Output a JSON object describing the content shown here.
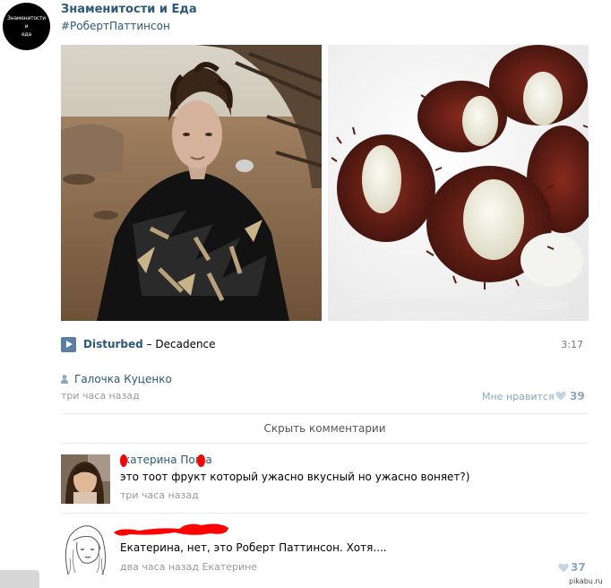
{
  "group": {
    "avatar_lines": [
      "Знаменитости",
      "и",
      "еда"
    ],
    "name": "Знаменитости и Еда",
    "hashtag": "#РобертПаттинсон"
  },
  "audio": {
    "artist": "Disturbed",
    "separator": " – ",
    "title": "Decadence",
    "duration": "3:17"
  },
  "post": {
    "author": "Галочка Куценко",
    "time": "три часа назад",
    "like_label": "Мне нравится",
    "like_count": "39"
  },
  "hide_comments_label": "Скрыть комментарии",
  "comments": [
    {
      "author": "Екатерина Попова",
      "author_visible": "катерина Поп а",
      "text": "это тоот фрукт который ужасно вкусный но ужасно воняет?)",
      "time": "три часа назад"
    },
    {
      "author": "",
      "text": "Екатерина, нет, это Роберт Паттинсон. Хотя....",
      "time": "два часа назад Екатерине",
      "like_count": "37"
    }
  ],
  "watermark": "pikabu.ru",
  "colors": {
    "link": "#2b587a",
    "muted": "#999999",
    "like": "#8da6bf",
    "play": "#597da3",
    "redaction": "#ff0000"
  },
  "icons": {
    "play": "play-icon",
    "user": "user-icon",
    "heart": "heart-icon"
  }
}
